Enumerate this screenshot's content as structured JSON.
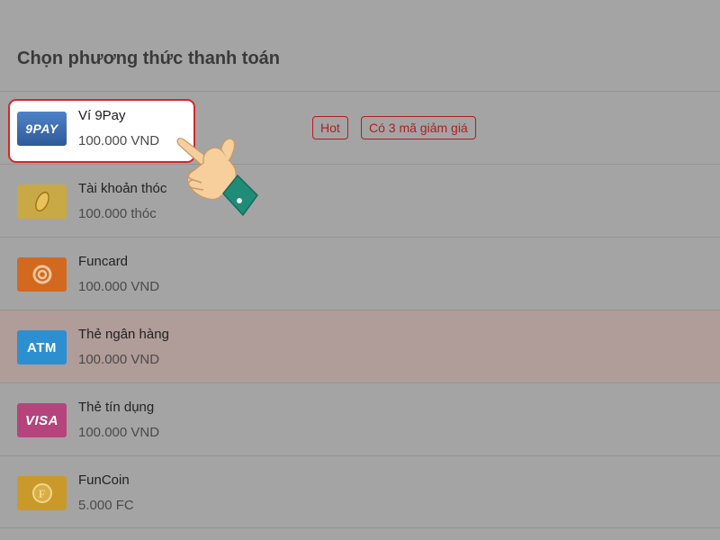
{
  "page": {
    "title": "Chọn phương thức thanh toán"
  },
  "methods": [
    {
      "name": "Ví 9Pay",
      "amount": "100.000 VND",
      "logo_text": "9PAY",
      "logo_color": "#3f6fb6",
      "selected": true
    },
    {
      "name": "Tài khoản thóc",
      "amount": "100.000 thóc",
      "logo_text": "",
      "logo_color": "#c8a946",
      "icon": "grain-icon"
    },
    {
      "name": "Funcard",
      "amount": "100.000 VND",
      "logo_text": "",
      "logo_color": "#d2691e",
      "icon": "swirl-icon"
    },
    {
      "name": "Thẻ ngân hàng",
      "amount": "100.000 VND",
      "logo_text": "ATM",
      "logo_color": "#2c8fd0",
      "highlighted": true
    },
    {
      "name": "Thẻ tín dụng",
      "amount": "100.000 VND",
      "logo_text": "VISA",
      "logo_color": "#b5447c"
    },
    {
      "name": "FunCoin",
      "amount": "5.000 FC",
      "logo_text": "",
      "logo_color": "#c99a2a",
      "icon": "coin-icon"
    }
  ],
  "badges": {
    "hot": "Hot",
    "promo": "Có 3 mã giảm giá"
  },
  "colors": {
    "accent": "#d6262b",
    "overlay": "#a4a4a4"
  }
}
